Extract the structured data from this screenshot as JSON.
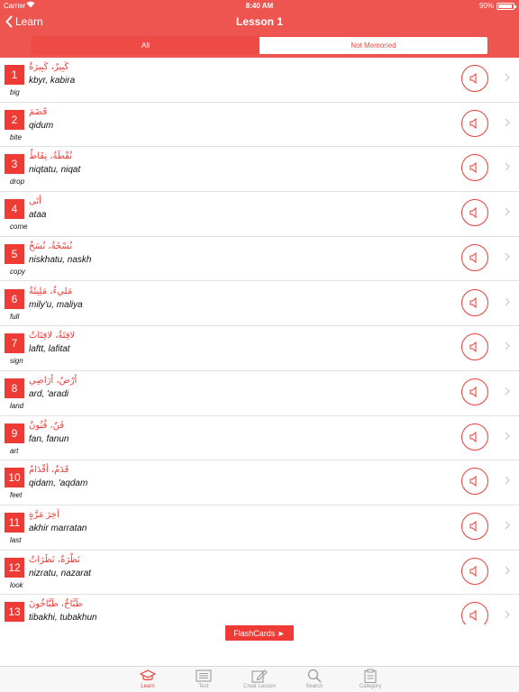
{
  "status": {
    "carrier": "Carrier",
    "time": "8:40 AM",
    "battery": "90%"
  },
  "nav": {
    "back_label": "Learn",
    "title": "Lesson 1"
  },
  "segments": [
    {
      "label": "All",
      "active": true
    },
    {
      "label": "Not Memoried",
      "active": false
    }
  ],
  "words": [
    {
      "num": "1",
      "arabic": "كَبِيرٌ، كَبِيرَةٌ",
      "translit": "kbyr, kabira",
      "meaning": "big"
    },
    {
      "num": "2",
      "arabic": "قَضَمَ",
      "translit": "qidum",
      "meaning": "bite"
    },
    {
      "num": "3",
      "arabic": "نُقْطَةٌ، نِقَاطٌ",
      "translit": "niqtatu, niqat",
      "meaning": "drop"
    },
    {
      "num": "4",
      "arabic": "أتَى",
      "translit": "ataa",
      "meaning": "come"
    },
    {
      "num": "5",
      "arabic": "نُسْخَةٌ، نُسَخٌ",
      "translit": "niskhatu, naskh",
      "meaning": "copy"
    },
    {
      "num": "6",
      "arabic": "مَليءٌ، مَلِيئَةٌ",
      "translit": "mily'u, maliya",
      "meaning": "full"
    },
    {
      "num": "7",
      "arabic": "لافِتَةٌ، لافِتَاتٌ",
      "translit": "laftt, lafitat",
      "meaning": "sign"
    },
    {
      "num": "8",
      "arabic": "أرْضٌ، أرَاضِي",
      "translit": "ard, 'aradi",
      "meaning": "land"
    },
    {
      "num": "9",
      "arabic": "فَنٌ، فُنُونٌ",
      "translit": "fan, fanun",
      "meaning": "art"
    },
    {
      "num": "10",
      "arabic": "قَدَمٌ، أقْدَامٌ",
      "translit": "qidam, 'aqdam",
      "meaning": "feet"
    },
    {
      "num": "11",
      "arabic": "آخِرَ مَرَّةٍ",
      "translit": "akhir marratan",
      "meaning": "last"
    },
    {
      "num": "12",
      "arabic": "نَظْرَةٌ، نَظَرَاتٌ",
      "translit": "nizratu, nazarat",
      "meaning": "look"
    },
    {
      "num": "13",
      "arabic": "طَبَّاخٌ، طَبَّاخُونَ",
      "translit": "tibakhi, tubakhun",
      "meaning": ""
    }
  ],
  "flashcards": {
    "label": "FlashCards ►"
  },
  "tabs": [
    {
      "label": "Learn",
      "icon": "graduation-cap-icon",
      "active": true
    },
    {
      "label": "Test",
      "icon": "list-icon",
      "active": false
    },
    {
      "label": "Creat Lesson",
      "icon": "pencil-icon",
      "active": false
    },
    {
      "label": "Search",
      "icon": "search-icon",
      "active": false
    },
    {
      "label": "Category",
      "icon": "clipboard-icon",
      "active": false
    }
  ],
  "colors": {
    "accent": "#ee3b36",
    "header": "#ef5550",
    "tabbar": "#f7f7f7",
    "inactive": "#9a9a9a"
  }
}
